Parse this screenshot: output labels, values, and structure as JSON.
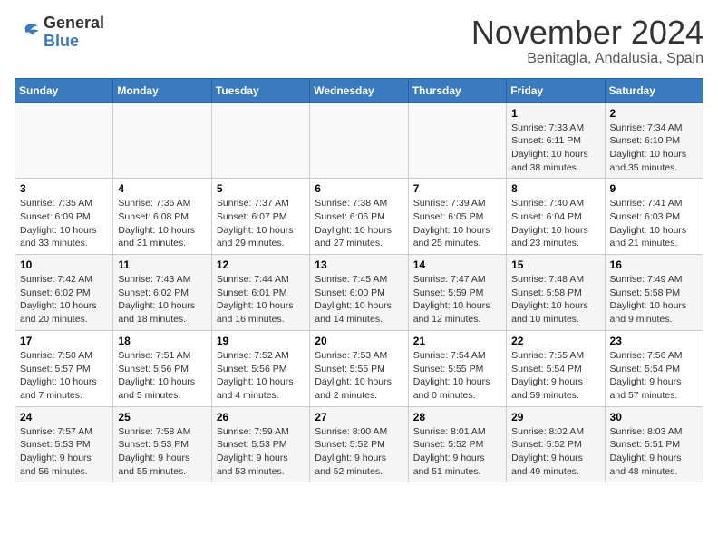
{
  "header": {
    "logo_general": "General",
    "logo_blue": "Blue",
    "month_year": "November 2024",
    "location": "Benitagla, Andalusia, Spain"
  },
  "calendar": {
    "days_of_week": [
      "Sunday",
      "Monday",
      "Tuesday",
      "Wednesday",
      "Thursday",
      "Friday",
      "Saturday"
    ],
    "weeks": [
      [
        {
          "day": "",
          "info": ""
        },
        {
          "day": "",
          "info": ""
        },
        {
          "day": "",
          "info": ""
        },
        {
          "day": "",
          "info": ""
        },
        {
          "day": "",
          "info": ""
        },
        {
          "day": "1",
          "info": "Sunrise: 7:33 AM\nSunset: 6:11 PM\nDaylight: 10 hours and 38 minutes."
        },
        {
          "day": "2",
          "info": "Sunrise: 7:34 AM\nSunset: 6:10 PM\nDaylight: 10 hours and 35 minutes."
        }
      ],
      [
        {
          "day": "3",
          "info": "Sunrise: 7:35 AM\nSunset: 6:09 PM\nDaylight: 10 hours and 33 minutes."
        },
        {
          "day": "4",
          "info": "Sunrise: 7:36 AM\nSunset: 6:08 PM\nDaylight: 10 hours and 31 minutes."
        },
        {
          "day": "5",
          "info": "Sunrise: 7:37 AM\nSunset: 6:07 PM\nDaylight: 10 hours and 29 minutes."
        },
        {
          "day": "6",
          "info": "Sunrise: 7:38 AM\nSunset: 6:06 PM\nDaylight: 10 hours and 27 minutes."
        },
        {
          "day": "7",
          "info": "Sunrise: 7:39 AM\nSunset: 6:05 PM\nDaylight: 10 hours and 25 minutes."
        },
        {
          "day": "8",
          "info": "Sunrise: 7:40 AM\nSunset: 6:04 PM\nDaylight: 10 hours and 23 minutes."
        },
        {
          "day": "9",
          "info": "Sunrise: 7:41 AM\nSunset: 6:03 PM\nDaylight: 10 hours and 21 minutes."
        }
      ],
      [
        {
          "day": "10",
          "info": "Sunrise: 7:42 AM\nSunset: 6:02 PM\nDaylight: 10 hours and 20 minutes."
        },
        {
          "day": "11",
          "info": "Sunrise: 7:43 AM\nSunset: 6:02 PM\nDaylight: 10 hours and 18 minutes."
        },
        {
          "day": "12",
          "info": "Sunrise: 7:44 AM\nSunset: 6:01 PM\nDaylight: 10 hours and 16 minutes."
        },
        {
          "day": "13",
          "info": "Sunrise: 7:45 AM\nSunset: 6:00 PM\nDaylight: 10 hours and 14 minutes."
        },
        {
          "day": "14",
          "info": "Sunrise: 7:47 AM\nSunset: 5:59 PM\nDaylight: 10 hours and 12 minutes."
        },
        {
          "day": "15",
          "info": "Sunrise: 7:48 AM\nSunset: 5:58 PM\nDaylight: 10 hours and 10 minutes."
        },
        {
          "day": "16",
          "info": "Sunrise: 7:49 AM\nSunset: 5:58 PM\nDaylight: 10 hours and 9 minutes."
        }
      ],
      [
        {
          "day": "17",
          "info": "Sunrise: 7:50 AM\nSunset: 5:57 PM\nDaylight: 10 hours and 7 minutes."
        },
        {
          "day": "18",
          "info": "Sunrise: 7:51 AM\nSunset: 5:56 PM\nDaylight: 10 hours and 5 minutes."
        },
        {
          "day": "19",
          "info": "Sunrise: 7:52 AM\nSunset: 5:56 PM\nDaylight: 10 hours and 4 minutes."
        },
        {
          "day": "20",
          "info": "Sunrise: 7:53 AM\nSunset: 5:55 PM\nDaylight: 10 hours and 2 minutes."
        },
        {
          "day": "21",
          "info": "Sunrise: 7:54 AM\nSunset: 5:55 PM\nDaylight: 10 hours and 0 minutes."
        },
        {
          "day": "22",
          "info": "Sunrise: 7:55 AM\nSunset: 5:54 PM\nDaylight: 9 hours and 59 minutes."
        },
        {
          "day": "23",
          "info": "Sunrise: 7:56 AM\nSunset: 5:54 PM\nDaylight: 9 hours and 57 minutes."
        }
      ],
      [
        {
          "day": "24",
          "info": "Sunrise: 7:57 AM\nSunset: 5:53 PM\nDaylight: 9 hours and 56 minutes."
        },
        {
          "day": "25",
          "info": "Sunrise: 7:58 AM\nSunset: 5:53 PM\nDaylight: 9 hours and 55 minutes."
        },
        {
          "day": "26",
          "info": "Sunrise: 7:59 AM\nSunset: 5:53 PM\nDaylight: 9 hours and 53 minutes."
        },
        {
          "day": "27",
          "info": "Sunrise: 8:00 AM\nSunset: 5:52 PM\nDaylight: 9 hours and 52 minutes."
        },
        {
          "day": "28",
          "info": "Sunrise: 8:01 AM\nSunset: 5:52 PM\nDaylight: 9 hours and 51 minutes."
        },
        {
          "day": "29",
          "info": "Sunrise: 8:02 AM\nSunset: 5:52 PM\nDaylight: 9 hours and 49 minutes."
        },
        {
          "day": "30",
          "info": "Sunrise: 8:03 AM\nSunset: 5:51 PM\nDaylight: 9 hours and 48 minutes."
        }
      ]
    ]
  }
}
